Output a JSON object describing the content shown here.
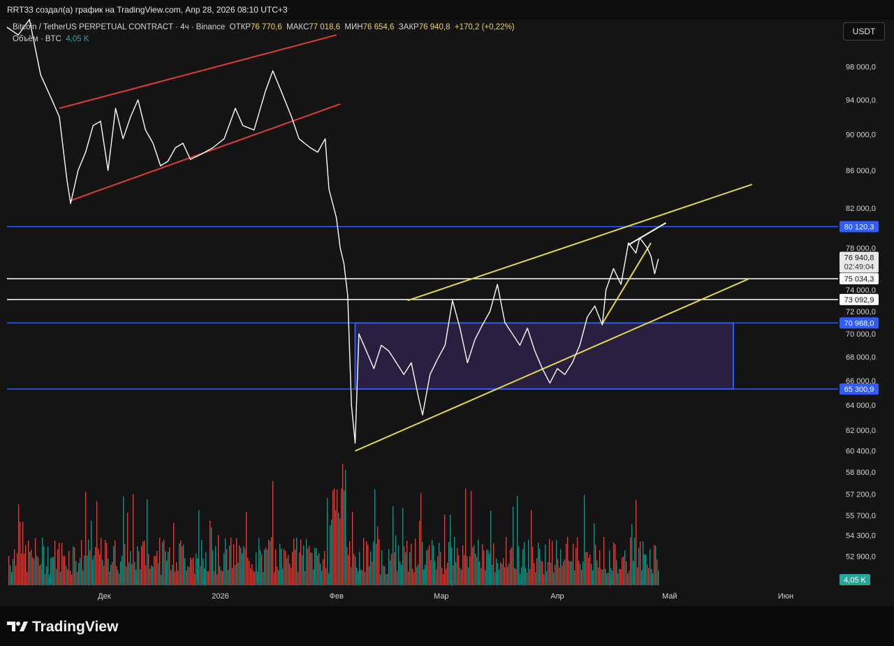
{
  "header": {
    "publisher_line": "RRT33 создал(а) график на TradingView.com, Апр 28, 2026 08:10 UTC+3"
  },
  "legend": {
    "symbol": "Bitcoin / TetherUS PERPETUAL CONTRACT · 4ч · Binance",
    "open_label": "ОТКР",
    "open_value": "76 770,6",
    "high_label": "МАКС",
    "high_value": "77 018,6",
    "low_label": "МИН",
    "low_value": "76 654,6",
    "close_label": "ЗАКР",
    "close_value": "76 940,8",
    "change": "+170,2 (+0,22%)",
    "volume_label": "Объём · BTC",
    "volume_value": "4,05 K"
  },
  "currency_button": "USDT",
  "footer": {
    "brand": "TradingView"
  },
  "colors": {
    "background": "#141414",
    "candle_line": "#ffffff",
    "wedge_red": "#e03c3c",
    "channel_yellow": "#e6d84a",
    "level_blue": "#2f5bff",
    "range_fill": "#3a2a66",
    "volume_up": "#26a69a",
    "volume_down": "#ef5350"
  },
  "chart_data": {
    "type": "line",
    "title": "Bitcoin / TetherUS PERPETUAL CONTRACT · 4ч · Binance",
    "scale": "log",
    "ylim": [
      51000,
      104000
    ],
    "y_ticks": [
      {
        "value": 98000,
        "label": "98 000,0"
      },
      {
        "value": 94000,
        "label": "94 000,0"
      },
      {
        "value": 90000,
        "label": "90 000,0"
      },
      {
        "value": 86000,
        "label": "86 000,0"
      },
      {
        "value": 82000,
        "label": "82 000,0"
      },
      {
        "value": 78000,
        "label": "78 000,0"
      },
      {
        "value": 74000,
        "label": "74 000,0"
      },
      {
        "value": 72000,
        "label": "72 000,0"
      },
      {
        "value": 70000,
        "label": "70 000,0"
      },
      {
        "value": 68000,
        "label": "68 000,0"
      },
      {
        "value": 66000,
        "label": "66 000,0"
      },
      {
        "value": 64000,
        "label": "64 000,0"
      },
      {
        "value": 62000,
        "label": "62 000,0"
      },
      {
        "value": 60400,
        "label": "60 400,0"
      },
      {
        "value": 58800,
        "label": "58 800,0"
      },
      {
        "value": 57200,
        "label": "57 200,0"
      },
      {
        "value": 55700,
        "label": "55 700,0"
      },
      {
        "value": 54300,
        "label": "54 300,0"
      },
      {
        "value": 52900,
        "label": "52 900,0"
      }
    ],
    "x_ticks": [
      {
        "date": "2025-12-01",
        "label": "Дек"
      },
      {
        "date": "2026-01-01",
        "label": "2026"
      },
      {
        "date": "2026-02-01",
        "label": "Фев"
      },
      {
        "date": "2026-03-01",
        "label": "Мар"
      },
      {
        "date": "2026-04-01",
        "label": "Апр"
      },
      {
        "date": "2026-05-01",
        "label": "Май"
      },
      {
        "date": "2026-06-01",
        "label": "Июн"
      }
    ],
    "xlim": [
      "2025-11-05",
      "2026-06-15"
    ],
    "price_series": [
      {
        "x": "2025-11-05",
        "y": 103000
      },
      {
        "x": "2025-11-08",
        "y": 102000
      },
      {
        "x": "2025-11-11",
        "y": 104000
      },
      {
        "x": "2025-11-14",
        "y": 97000
      },
      {
        "x": "2025-11-17",
        "y": 94000
      },
      {
        "x": "2025-11-19",
        "y": 92000
      },
      {
        "x": "2025-11-21",
        "y": 85000
      },
      {
        "x": "2025-11-22",
        "y": 82500
      },
      {
        "x": "2025-11-24",
        "y": 86000
      },
      {
        "x": "2025-11-26",
        "y": 88000
      },
      {
        "x": "2025-11-28",
        "y": 91000
      },
      {
        "x": "2025-11-30",
        "y": 91500
      },
      {
        "x": "2025-12-02",
        "y": 86000
      },
      {
        "x": "2025-12-04",
        "y": 93000
      },
      {
        "x": "2025-12-06",
        "y": 89500
      },
      {
        "x": "2025-12-08",
        "y": 92000
      },
      {
        "x": "2025-12-10",
        "y": 94000
      },
      {
        "x": "2025-12-12",
        "y": 90500
      },
      {
        "x": "2025-12-14",
        "y": 89000
      },
      {
        "x": "2025-12-16",
        "y": 86500
      },
      {
        "x": "2025-12-18",
        "y": 87000
      },
      {
        "x": "2025-12-20",
        "y": 88500
      },
      {
        "x": "2025-12-22",
        "y": 89000
      },
      {
        "x": "2025-12-24",
        "y": 87200
      },
      {
        "x": "2025-12-27",
        "y": 87800
      },
      {
        "x": "2025-12-30",
        "y": 88500
      },
      {
        "x": "2026-01-02",
        "y": 89500
      },
      {
        "x": "2026-01-05",
        "y": 93000
      },
      {
        "x": "2026-01-07",
        "y": 91000
      },
      {
        "x": "2026-01-10",
        "y": 90500
      },
      {
        "x": "2026-01-13",
        "y": 95000
      },
      {
        "x": "2026-01-15",
        "y": 97500
      },
      {
        "x": "2026-01-17",
        "y": 95300
      },
      {
        "x": "2026-01-20",
        "y": 92000
      },
      {
        "x": "2026-01-22",
        "y": 89500
      },
      {
        "x": "2026-01-25",
        "y": 88500
      },
      {
        "x": "2026-01-27",
        "y": 88000
      },
      {
        "x": "2026-01-29",
        "y": 89500
      },
      {
        "x": "2026-01-30",
        "y": 84000
      },
      {
        "x": "2026-02-01",
        "y": 81000
      },
      {
        "x": "2026-02-02",
        "y": 78000
      },
      {
        "x": "2026-02-03",
        "y": 76500
      },
      {
        "x": "2026-02-04",
        "y": 73500
      },
      {
        "x": "2026-02-05",
        "y": 64000
      },
      {
        "x": "2026-02-06",
        "y": 61000
      },
      {
        "x": "2026-02-07",
        "y": 70000
      },
      {
        "x": "2026-02-09",
        "y": 68500
      },
      {
        "x": "2026-02-11",
        "y": 67000
      },
      {
        "x": "2026-02-13",
        "y": 69000
      },
      {
        "x": "2026-02-15",
        "y": 68500
      },
      {
        "x": "2026-02-17",
        "y": 67500
      },
      {
        "x": "2026-02-19",
        "y": 66500
      },
      {
        "x": "2026-02-21",
        "y": 67500
      },
      {
        "x": "2026-02-23",
        "y": 64500
      },
      {
        "x": "2026-02-24",
        "y": 63200
      },
      {
        "x": "2026-02-26",
        "y": 66500
      },
      {
        "x": "2026-02-28",
        "y": 67800
      },
      {
        "x": "2026-03-02",
        "y": 69000
      },
      {
        "x": "2026-03-04",
        "y": 73000
      },
      {
        "x": "2026-03-06",
        "y": 70500
      },
      {
        "x": "2026-03-08",
        "y": 67500
      },
      {
        "x": "2026-03-10",
        "y": 69500
      },
      {
        "x": "2026-03-12",
        "y": 70800
      },
      {
        "x": "2026-03-14",
        "y": 72000
      },
      {
        "x": "2026-03-16",
        "y": 74500
      },
      {
        "x": "2026-03-18",
        "y": 71000
      },
      {
        "x": "2026-03-20",
        "y": 70000
      },
      {
        "x": "2026-03-22",
        "y": 69000
      },
      {
        "x": "2026-03-24",
        "y": 70500
      },
      {
        "x": "2026-03-26",
        "y": 68500
      },
      {
        "x": "2026-03-28",
        "y": 67000
      },
      {
        "x": "2026-03-30",
        "y": 65800
      },
      {
        "x": "2026-04-01",
        "y": 67000
      },
      {
        "x": "2026-04-03",
        "y": 66500
      },
      {
        "x": "2026-04-05",
        "y": 67500
      },
      {
        "x": "2026-04-07",
        "y": 69000
      },
      {
        "x": "2026-04-09",
        "y": 71500
      },
      {
        "x": "2026-04-11",
        "y": 72500
      },
      {
        "x": "2026-04-13",
        "y": 70800
      },
      {
        "x": "2026-04-14",
        "y": 74000
      },
      {
        "x": "2026-04-16",
        "y": 76000
      },
      {
        "x": "2026-04-18",
        "y": 74500
      },
      {
        "x": "2026-04-20",
        "y": 78500
      },
      {
        "x": "2026-04-22",
        "y": 77500
      },
      {
        "x": "2026-04-23",
        "y": 79000
      },
      {
        "x": "2026-04-25",
        "y": 78000
      },
      {
        "x": "2026-04-26",
        "y": 77200
      },
      {
        "x": "2026-04-27",
        "y": 75500
      },
      {
        "x": "2026-04-28",
        "y": 76940.8
      }
    ],
    "volume_series": {
      "name": "Объём · BTC",
      "last_value": "4,05 K"
    },
    "horizontal_levels": [
      {
        "value": 80120.3,
        "label": "80 120,3",
        "color": "#2f5bff"
      },
      {
        "value": 75034.3,
        "label": "75 034,3",
        "color": "#ffffff"
      },
      {
        "value": 73092.9,
        "label": "73 092,9",
        "color": "#ffffff"
      },
      {
        "value": 70968.0,
        "label": "70 968,0",
        "color": "#2f5bff"
      },
      {
        "value": 65300.9,
        "label": "65 300,9",
        "color": "#2f5bff"
      }
    ],
    "range_box": {
      "x_start": "2026-02-06",
      "x_end": "2026-05-18",
      "y_top": 70968.0,
      "y_bottom": 65300.9
    },
    "trendlines": [
      {
        "color": "#e03c3c",
        "from": {
          "x": "2025-11-19",
          "y": 93000
        },
        "to": {
          "x": "2026-02-01",
          "y": 102000
        }
      },
      {
        "color": "#e03c3c",
        "from": {
          "x": "2025-11-22",
          "y": 82800
        },
        "to": {
          "x": "2026-02-02",
          "y": 93500
        }
      },
      {
        "color": "#e6d84a",
        "from": {
          "x": "2026-02-06",
          "y": 60400
        },
        "to": {
          "x": "2026-05-22",
          "y": 75000
        }
      },
      {
        "color": "#e6d84a",
        "from": {
          "x": "2026-02-20",
          "y": 73000
        },
        "to": {
          "x": "2026-05-23",
          "y": 84500
        }
      },
      {
        "color": "#e6d84a",
        "from": {
          "x": "2026-04-13",
          "y": 70900
        },
        "to": {
          "x": "2026-04-26",
          "y": 78500
        }
      },
      {
        "color": "#ffffff",
        "from": {
          "x": "2026-04-20",
          "y": 78300
        },
        "to": {
          "x": "2026-04-30",
          "y": 80500
        }
      }
    ],
    "last_price": {
      "label": "76 940,8",
      "countdown": "02:49:04"
    }
  }
}
